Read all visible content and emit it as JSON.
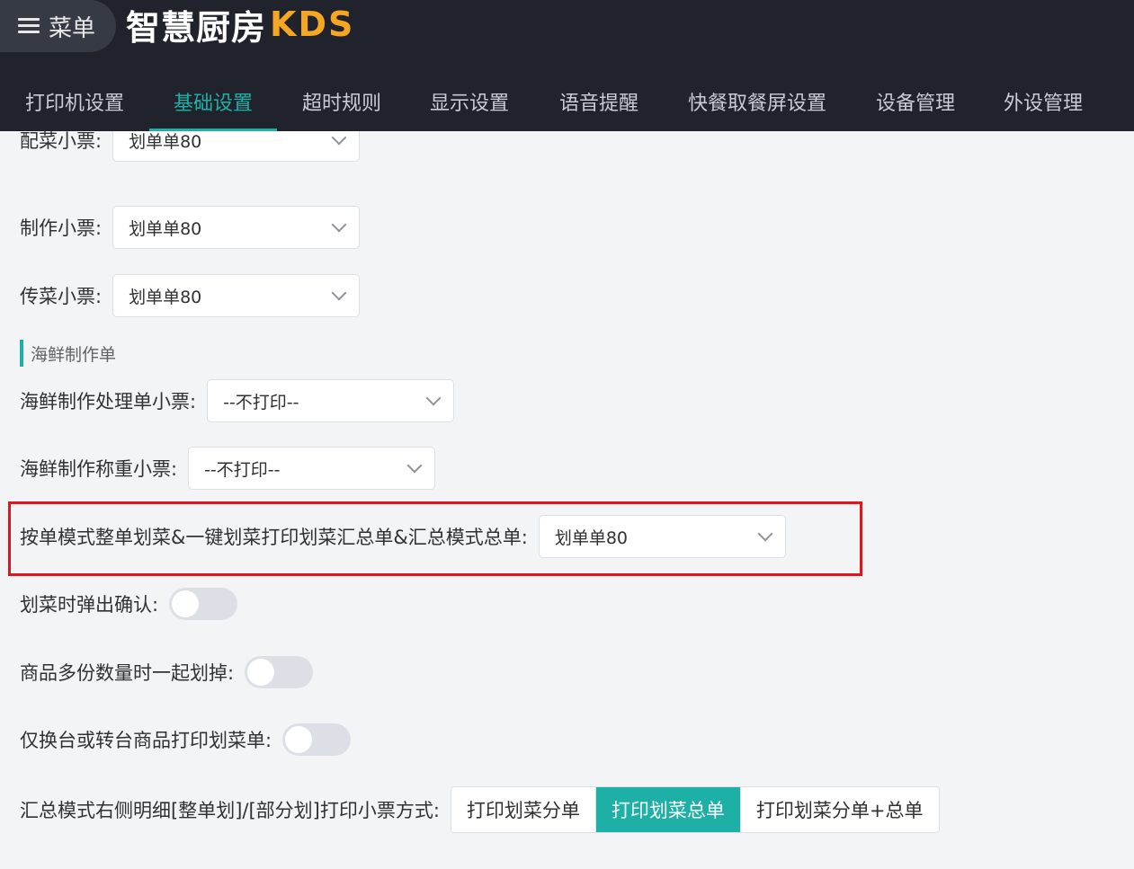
{
  "header": {
    "menu_label": "菜单",
    "logo_cn": "智慧厨房",
    "logo_en": "KDS"
  },
  "tabs": [
    {
      "label": "打印机设置",
      "active": false
    },
    {
      "label": "基础设置",
      "active": true
    },
    {
      "label": "超时规则",
      "active": false
    },
    {
      "label": "显示设置",
      "active": false
    },
    {
      "label": "语音提醒",
      "active": false
    },
    {
      "label": "快餐取餐屏设置",
      "active": false
    },
    {
      "label": "设备管理",
      "active": false
    },
    {
      "label": "外设管理",
      "active": false
    }
  ],
  "form": {
    "peicai": {
      "label": "配菜小票:",
      "value": "划单单80"
    },
    "zhizuo": {
      "label": "制作小票:",
      "value": "划单单80"
    },
    "chuancai": {
      "label": "传菜小票:",
      "value": "划单单80"
    },
    "seafood_section": "海鲜制作单",
    "seafood_process": {
      "label": "海鲜制作处理单小票:",
      "value": "--不打印--"
    },
    "seafood_weigh": {
      "label": "海鲜制作称重小票:",
      "value": "--不打印--"
    },
    "summary_ticket": {
      "label": "按单模式整单划菜&一键划菜打印划菜汇总单&汇总模式总单:",
      "value": "划单单80"
    },
    "confirm_popup": {
      "label": "划菜时弹出确认:",
      "on": false
    },
    "multi_qty": {
      "label": "商品多份数量时一起划掉:",
      "on": false
    },
    "table_change_print": {
      "label": "仅换台或转台商品打印划菜单:",
      "on": false
    },
    "print_mode": {
      "label": "汇总模式右侧明细[整单划]/[部分划]打印小票方式:",
      "options": [
        "打印划菜分单",
        "打印划菜总单",
        "打印划菜分单+总单"
      ],
      "selected": "打印划菜总单"
    }
  },
  "colors": {
    "accent": "#1cb0a6",
    "header_bg": "#20232b",
    "logo_orange": "#f5a623",
    "highlight_red": "#e0161c"
  }
}
